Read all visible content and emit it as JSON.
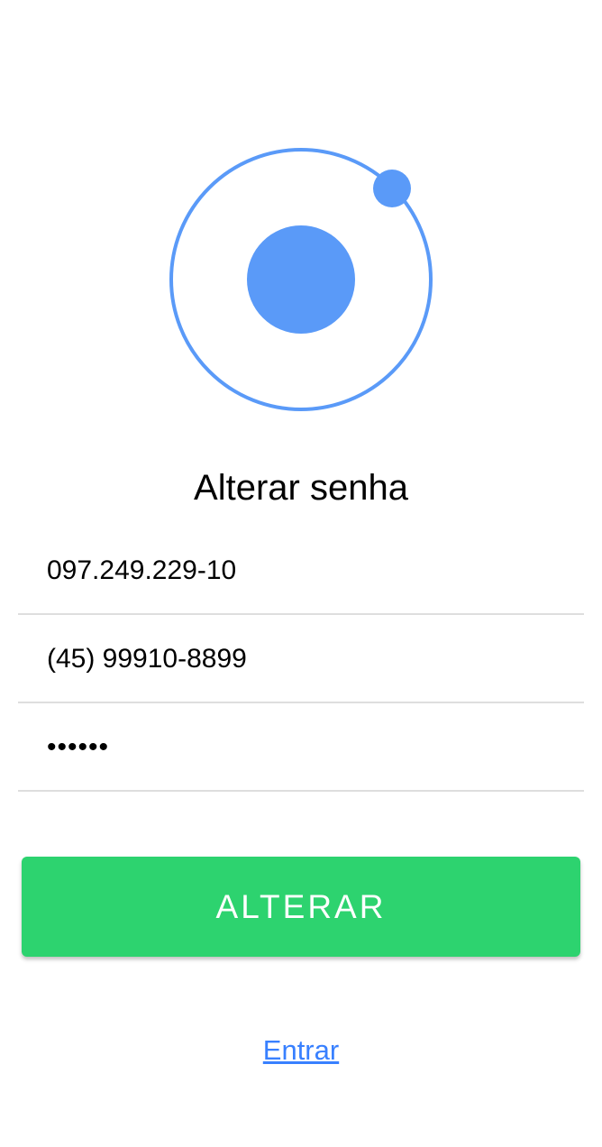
{
  "logo": {
    "icon": "ionic-logo-icon",
    "color": "#5a9af8"
  },
  "title": "Alterar senha",
  "form": {
    "cpf_value": "097.249.229-10",
    "phone_value": "(45) 99910-8899",
    "password_value": "••••••"
  },
  "submit_button": {
    "label": "ALTERAR",
    "color": "#2dd36f"
  },
  "login_link": {
    "label": "Entrar",
    "color": "#3880ff"
  }
}
